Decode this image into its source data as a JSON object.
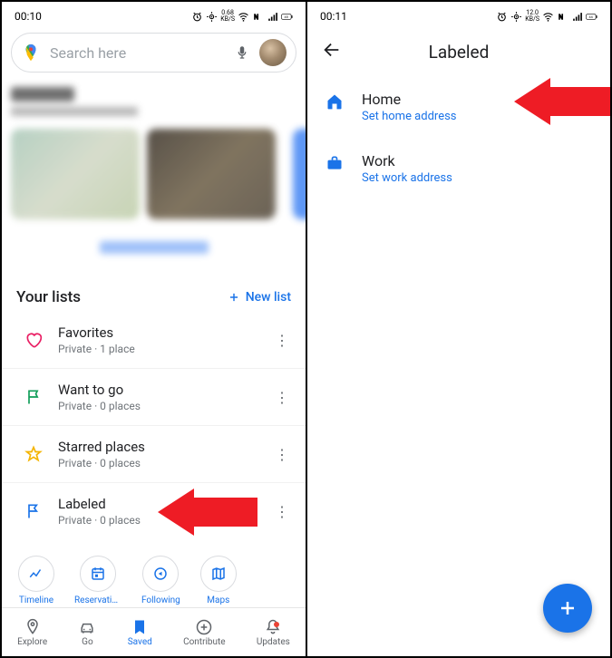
{
  "left": {
    "status": {
      "time": "00:10",
      "kb": "0.68",
      "kbu": "KB/S",
      "battery": "45"
    },
    "search": {
      "placeholder": "Search here"
    },
    "lists": {
      "header": "Your lists",
      "new": "New list",
      "items": [
        {
          "title": "Favorites",
          "sub": "Private · 1 place"
        },
        {
          "title": "Want to go",
          "sub": "Private · 0 places"
        },
        {
          "title": "Starred places",
          "sub": "Private · 0 places"
        },
        {
          "title": "Labeled",
          "sub": "Private · 0 places"
        }
      ]
    },
    "chips": [
      "Timeline",
      "Reservations",
      "Following",
      "Maps"
    ],
    "nav": [
      "Explore",
      "Go",
      "Saved",
      "Contribute",
      "Updates"
    ]
  },
  "right": {
    "status": {
      "time": "00:11",
      "kb": "12.0",
      "kbu": "KB/S",
      "battery": "44"
    },
    "header": "Labeled",
    "items": [
      {
        "title": "Home",
        "sub": "Set home address"
      },
      {
        "title": "Work",
        "sub": "Set work address"
      }
    ]
  }
}
